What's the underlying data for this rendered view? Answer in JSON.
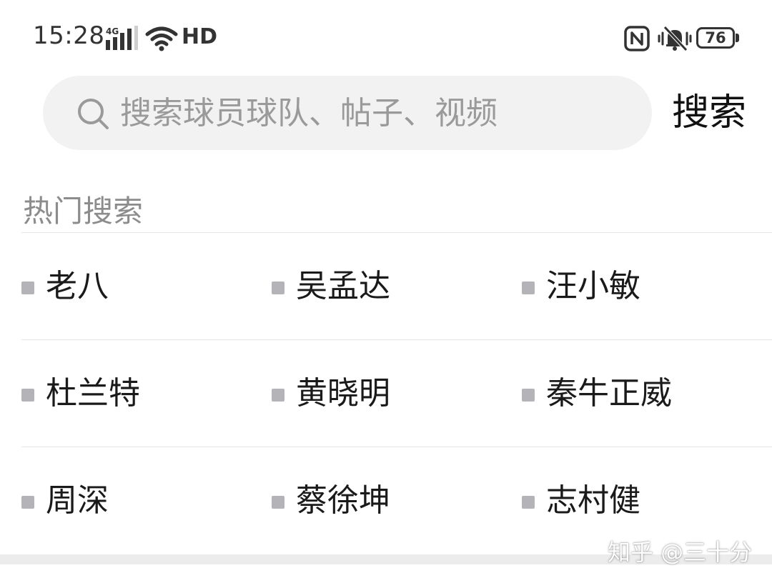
{
  "status_bar": {
    "time": "15:28",
    "network": "4G",
    "hd": "HD",
    "battery": "76"
  },
  "search": {
    "placeholder": "搜索球员球队、帖子、视频",
    "value": "",
    "button_label": "搜索"
  },
  "hot": {
    "title": "热门搜索",
    "items": [
      "老八",
      "吴孟达",
      "汪小敏",
      "杜兰特",
      "黄晓明",
      "秦牛正威",
      "周深",
      "蔡徐坤",
      "志村健"
    ]
  },
  "watermark": "知乎 @三十分",
  "colors": {
    "search_bg": "#f2f2f2",
    "bullet": "#b3b3b8",
    "section_title": "#8c8c8c",
    "divider": "#e6e6e6"
  }
}
